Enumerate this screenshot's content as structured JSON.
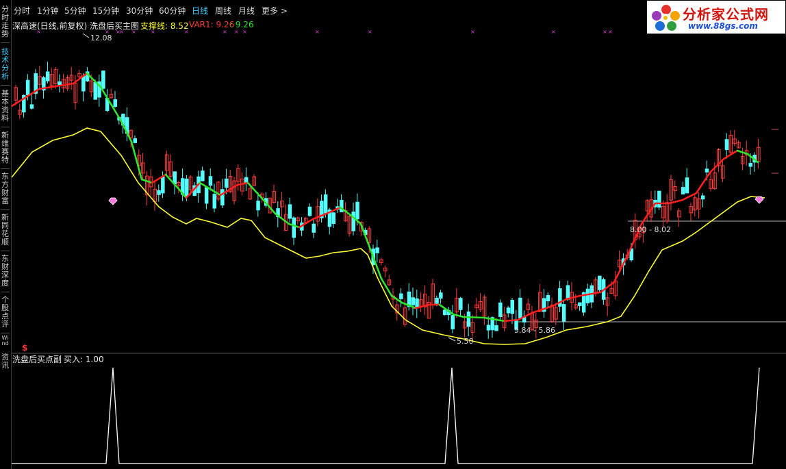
{
  "sidebar": {
    "items": [
      {
        "label": "分时走势"
      },
      {
        "label": "技术分析"
      },
      {
        "label": "基本资料"
      },
      {
        "label": "新维赛特"
      },
      {
        "label": "东方财富"
      },
      {
        "label": "新同花顺"
      },
      {
        "label": "东财深度"
      },
      {
        "label": "个股点评"
      },
      {
        "label": "Wind"
      },
      {
        "label": "资讯"
      }
    ]
  },
  "toolbar": {
    "tabs": [
      {
        "label": "分时"
      },
      {
        "label": "1分钟"
      },
      {
        "label": "5分钟"
      },
      {
        "label": "15分钟"
      },
      {
        "label": "30分钟"
      },
      {
        "label": "60分钟"
      },
      {
        "label": "日线"
      },
      {
        "label": "周线"
      },
      {
        "label": "月线"
      },
      {
        "label": "更多 >"
      }
    ]
  },
  "logo": {
    "name": "分析家公式网",
    "url": "www.88gs.com"
  },
  "main_panel": {
    "title": "深高速(日线,前复权) 洗盘后买主图",
    "support_label": "支撑线: 8.52",
    "var1_label": "VAR1: 9.26",
    "var1_value": ": 9.26",
    "price_high": "12.08",
    "price_low": "5.50",
    "range_label_1": "8.00 - 8.02",
    "range_label_2": "5.84 - 5.86",
    "marker_dollar": "$"
  },
  "sub_panel": {
    "title": "洗盘后买点副",
    "buy_label": "买入: 1.00",
    "signals": [
      0.0,
      1.0,
      0.0,
      1.0,
      0.0,
      1.0
    ]
  },
  "colors": {
    "up_candle": "#ff3b3b",
    "down_candle": "#54ffff",
    "ma_up": "#ff1e1e",
    "ma_down": "#2de62d",
    "support_line": "#ffff33",
    "tab_active": "#3fd2ff"
  }
}
